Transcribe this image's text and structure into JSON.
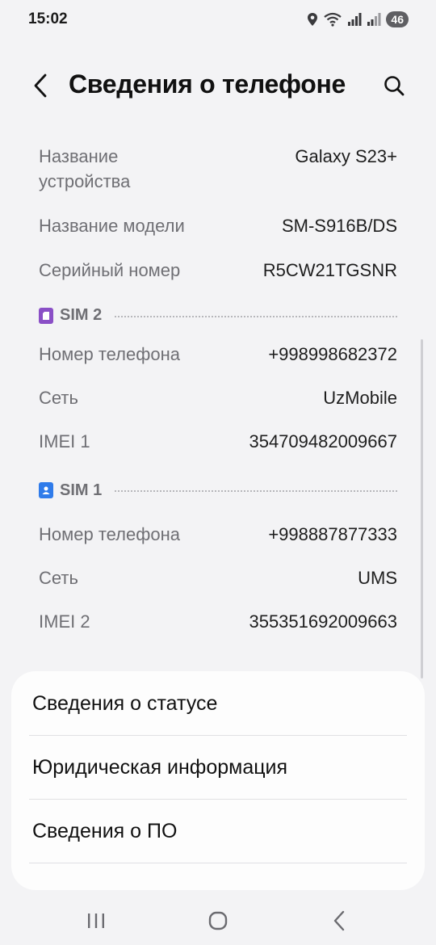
{
  "status_bar": {
    "time": "15:02",
    "battery": "46",
    "icons": [
      "location-icon",
      "wifi-icon",
      "signal-icon",
      "signal-icon"
    ]
  },
  "header": {
    "title": "Сведения о телефоне",
    "back_icon": "chevron-left-icon",
    "search_icon": "search-icon"
  },
  "device": {
    "name_label": "Название устройства",
    "name_value": "Galaxy S23+",
    "model_label": "Название модели",
    "model_value": "SM-S916B/DS",
    "serial_label": "Серийный номер",
    "serial_value": "R5CW21TGSNR"
  },
  "sim2": {
    "label": "SIM 2",
    "color": "#8a4fc6",
    "phone_label": "Номер телефона",
    "phone_value": "+998998682372",
    "network_label": "Сеть",
    "network_value": "UzMobile",
    "imei_label": "IMEI 1",
    "imei_value": "354709482009667"
  },
  "sim1": {
    "label": "SIM 1",
    "color": "#2f7bea",
    "phone_label": "Номер телефона",
    "phone_value": "+998887877333",
    "network_label": "Сеть",
    "network_value": "UMS",
    "imei_label": "IMEI 2",
    "imei_value": "355351692009663"
  },
  "menu": {
    "items": [
      {
        "label": "Сведения о статусе"
      },
      {
        "label": "Юридическая информация"
      },
      {
        "label": "Сведения о ПО"
      }
    ]
  },
  "nav": {
    "recents_icon": "recents-icon",
    "home_icon": "home-icon",
    "back_icon": "back-icon"
  }
}
